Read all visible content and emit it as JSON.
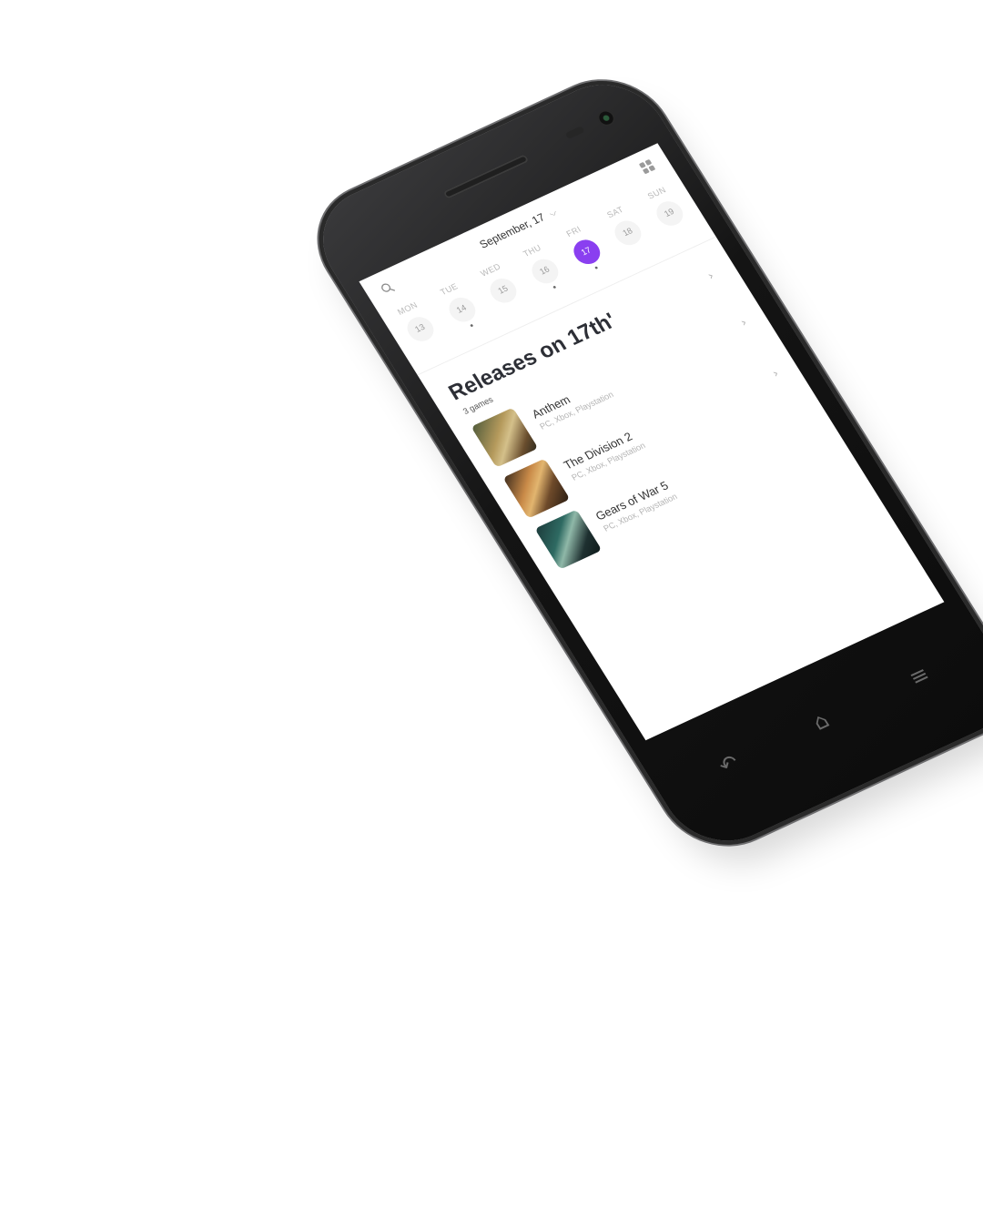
{
  "header": {
    "date_label": "September, 17",
    "dropdown_glyph": "⌵",
    "search_icon": "search-icon",
    "view_toggle_icon": "grid-icon"
  },
  "week": [
    {
      "name": "MON",
      "num": "13",
      "dot": false,
      "active": false
    },
    {
      "name": "TUE",
      "num": "14",
      "dot": true,
      "active": false
    },
    {
      "name": "WED",
      "num": "15",
      "dot": false,
      "active": false
    },
    {
      "name": "THU",
      "num": "16",
      "dot": true,
      "active": false
    },
    {
      "name": "FRI",
      "num": "17",
      "dot": true,
      "active": true
    },
    {
      "name": "SAT",
      "num": "18",
      "dot": false,
      "active": false
    },
    {
      "name": "SUN",
      "num": "19",
      "dot": false,
      "active": false
    }
  ],
  "releases": {
    "title": "Releases on 17th'",
    "count_label": "3 games",
    "chevron": "›",
    "games": [
      {
        "title": "Anthem",
        "platforms": "PC, Xbox, Playstation"
      },
      {
        "title": "The Division 2",
        "platforms": "PC, Xbox, Playstation"
      },
      {
        "title": "Gears of War 5",
        "platforms": "PC, Xbox, Playstation"
      }
    ]
  },
  "nav": {
    "back_glyph": "↶",
    "home_glyph": "⌂",
    "menu_glyph": "≡"
  },
  "colors": {
    "accent": "#8a3ff0",
    "phone_body": "#141414"
  }
}
